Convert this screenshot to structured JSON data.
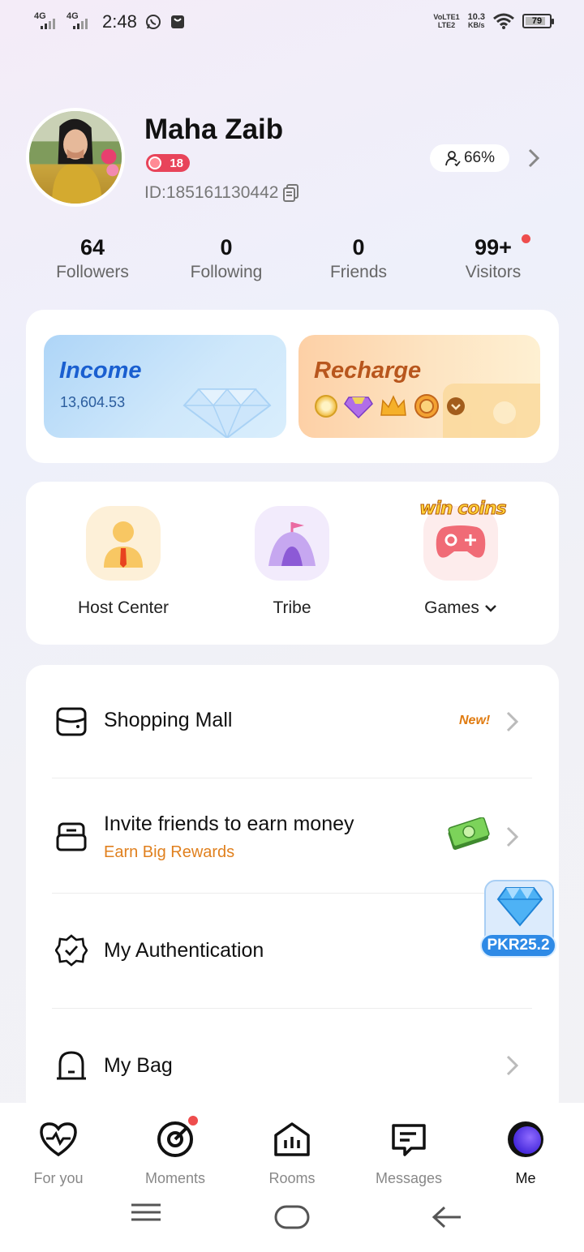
{
  "status_bar": {
    "sim1": "4G",
    "sim2": "4G",
    "time": "2:48",
    "volte_top": "VoLTE1",
    "volte_bottom": "LTE2",
    "speed_value": "10.3",
    "speed_unit": "KB/s",
    "battery": "79"
  },
  "profile": {
    "name": "Maha Zaib",
    "level": "18",
    "id_text": "ID:185161130442",
    "completion": "66%"
  },
  "stats": [
    {
      "value": "64",
      "label": "Followers"
    },
    {
      "value": "0",
      "label": "Following"
    },
    {
      "value": "0",
      "label": "Friends"
    },
    {
      "value": "99+",
      "label": "Visitors"
    }
  ],
  "wallet": {
    "income_title": "Income",
    "income_value": "13,604.53",
    "recharge_title": "Recharge"
  },
  "tools": [
    {
      "label": "Host Center"
    },
    {
      "label": "Tribe"
    },
    {
      "label": "Games"
    }
  ],
  "games_promo": "win coins",
  "menu": [
    {
      "title": "Shopping Mall",
      "badge": "New!"
    },
    {
      "title": "Invite friends to earn money",
      "subtitle": "Earn Big Rewards"
    },
    {
      "title": "My Authentication"
    },
    {
      "title": "My Bag"
    }
  ],
  "floating_reward": "PKR25.2",
  "bottom_nav": [
    {
      "label": "For you",
      "icon": "heartbeat-icon"
    },
    {
      "label": "Moments",
      "icon": "target-icon"
    },
    {
      "label": "Rooms",
      "icon": "house-chart-icon"
    },
    {
      "label": "Messages",
      "icon": "message-icon"
    },
    {
      "label": "Me",
      "icon": "profile-orb-icon"
    }
  ],
  "colors": {
    "accent_blue": "#1a5fd0",
    "accent_orange": "#b8561d",
    "level_red": "#e8445a",
    "badge_orange": "#e07b10",
    "notification_red": "#ee4d4d",
    "reward_blue": "#2e8ae6"
  }
}
